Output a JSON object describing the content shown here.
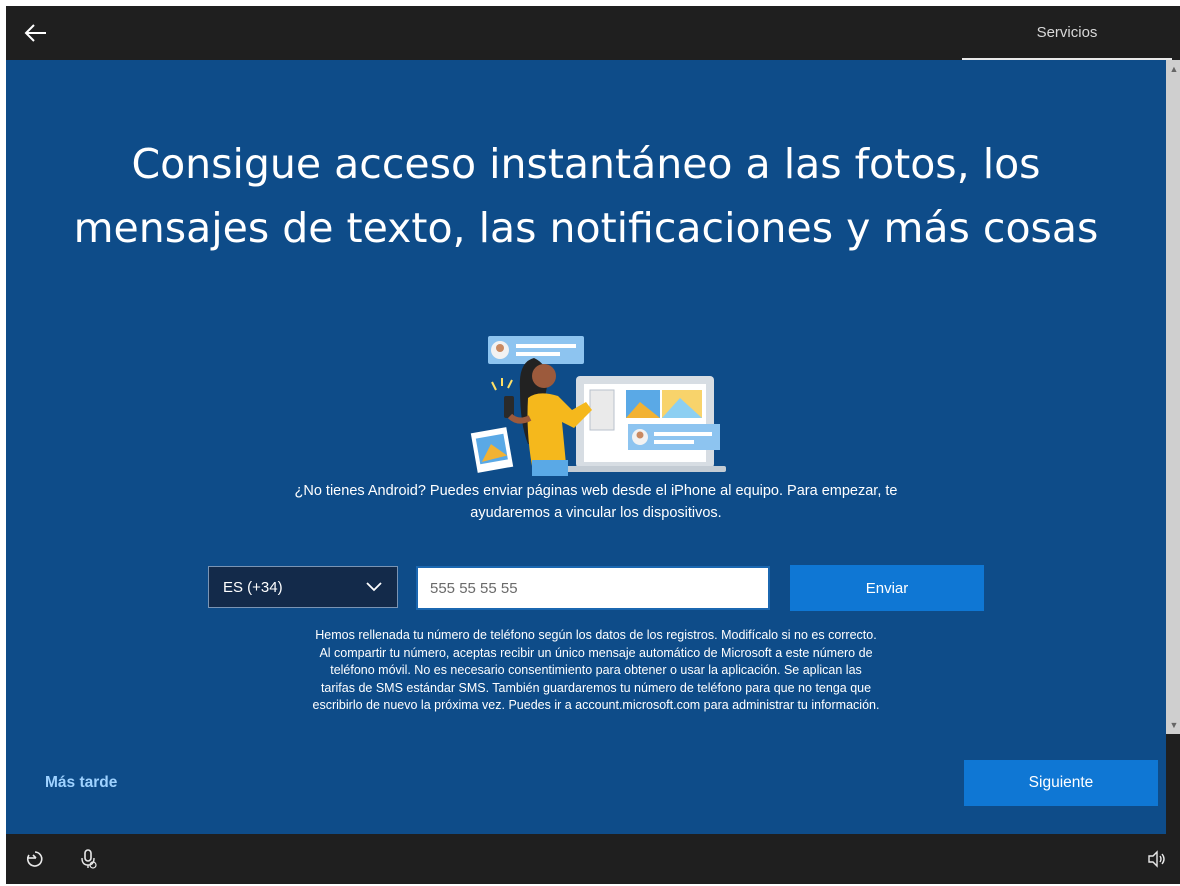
{
  "header": {
    "section_tab": "Servicios"
  },
  "main": {
    "headline_line1": "Consigue acceso instantáneo a las fotos, los",
    "headline_line2": "mensajes de texto, las notificaciones y más cosas",
    "description_line1": "¿No tienes Android? Puedes enviar páginas web desde el iPhone al equipo. Para empezar, te",
    "description_line2": "ayudaremos a vincular los dispositivos.",
    "country_select": {
      "selected": "ES (+34)"
    },
    "phone_input": {
      "value": "",
      "placeholder": "555 55 55 55"
    },
    "send_label": "Enviar",
    "legal_lines": [
      "Hemos rellenada tu número de teléfono según los datos de los registros. Modifícalo si no es correcto.",
      "Al compartir tu número, aceptas recibir un único mensaje automático de Microsoft a este número de",
      "teléfono móvil.  No es necesario consentimiento para obtener o usar la aplicación.  Se aplican las",
      "tarifas de SMS estándar SMS. También guardaremos tu número de teléfono para que no tenga que",
      "escribirlo de nuevo la próxima vez. Puedes ir a account.microsoft.com para administrar tu información."
    ]
  },
  "footer": {
    "later_label": "Más tarde",
    "next_label": "Siguiente"
  },
  "icons": {
    "back": "back-arrow-icon",
    "accessibility": "ease-of-access-icon",
    "microphone": "microphone-icon",
    "volume": "volume-icon"
  },
  "colors": {
    "background": "#0e4c89",
    "button": "#0f77d4",
    "link": "#9fd2ff",
    "chrome": "#1f1f1f"
  }
}
